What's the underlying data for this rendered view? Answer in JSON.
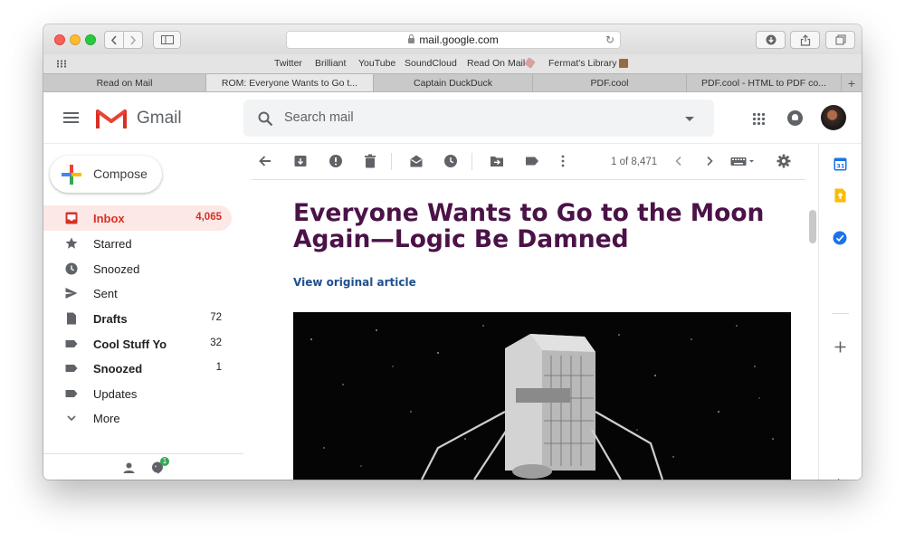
{
  "browser": {
    "url": "mail.google.com",
    "bookmarks": [
      "Twitter",
      "Brilliant",
      "YouTube",
      "SoundCloud",
      "Read On Mail",
      "Fermat's Library"
    ],
    "tabs": [
      {
        "label": "Read on Mail",
        "active": false
      },
      {
        "label": "ROM: Everyone Wants to Go t...",
        "active": true
      },
      {
        "label": "Captain DuckDuck",
        "active": false
      },
      {
        "label": "PDF.cool",
        "active": false
      },
      {
        "label": "PDF.cool - HTML to PDF co...",
        "active": false
      }
    ],
    "new_tab": "+"
  },
  "gmail": {
    "brand": "Gmail",
    "search_placeholder": "Search mail",
    "compose_label": "Compose",
    "nav": [
      {
        "label": "Inbox",
        "count": "4,065",
        "icon": "inbox-icon",
        "active": true,
        "bold": true
      },
      {
        "label": "Starred",
        "count": "",
        "icon": "star-icon",
        "active": false,
        "bold": false
      },
      {
        "label": "Snoozed",
        "count": "",
        "icon": "clock-icon",
        "active": false,
        "bold": false
      },
      {
        "label": "Sent",
        "count": "",
        "icon": "send-icon",
        "active": false,
        "bold": false
      },
      {
        "label": "Drafts",
        "count": "72",
        "icon": "draft-icon",
        "active": false,
        "bold": true
      },
      {
        "label": "Cool Stuff Yo",
        "count": "32",
        "icon": "label-icon",
        "active": false,
        "bold": true
      },
      {
        "label": "Snoozed",
        "count": "1",
        "icon": "label-icon",
        "active": false,
        "bold": true
      },
      {
        "label": "Updates",
        "count": "",
        "icon": "label-icon",
        "active": false,
        "bold": false
      },
      {
        "label": "More",
        "count": "",
        "icon": "chevron-down-icon",
        "active": false,
        "bold": false
      }
    ],
    "hangouts_badge": "1",
    "pager": "1 of 8,471"
  },
  "message": {
    "title": "Everyone Wants to Go to the Moon Again—Logic Be Damned",
    "link": "View original article"
  },
  "colors": {
    "title": "#4b1248",
    "link": "#1e4f8f",
    "inbox_active_bg": "#fce8e6",
    "inbox_active_text": "#d93025"
  }
}
